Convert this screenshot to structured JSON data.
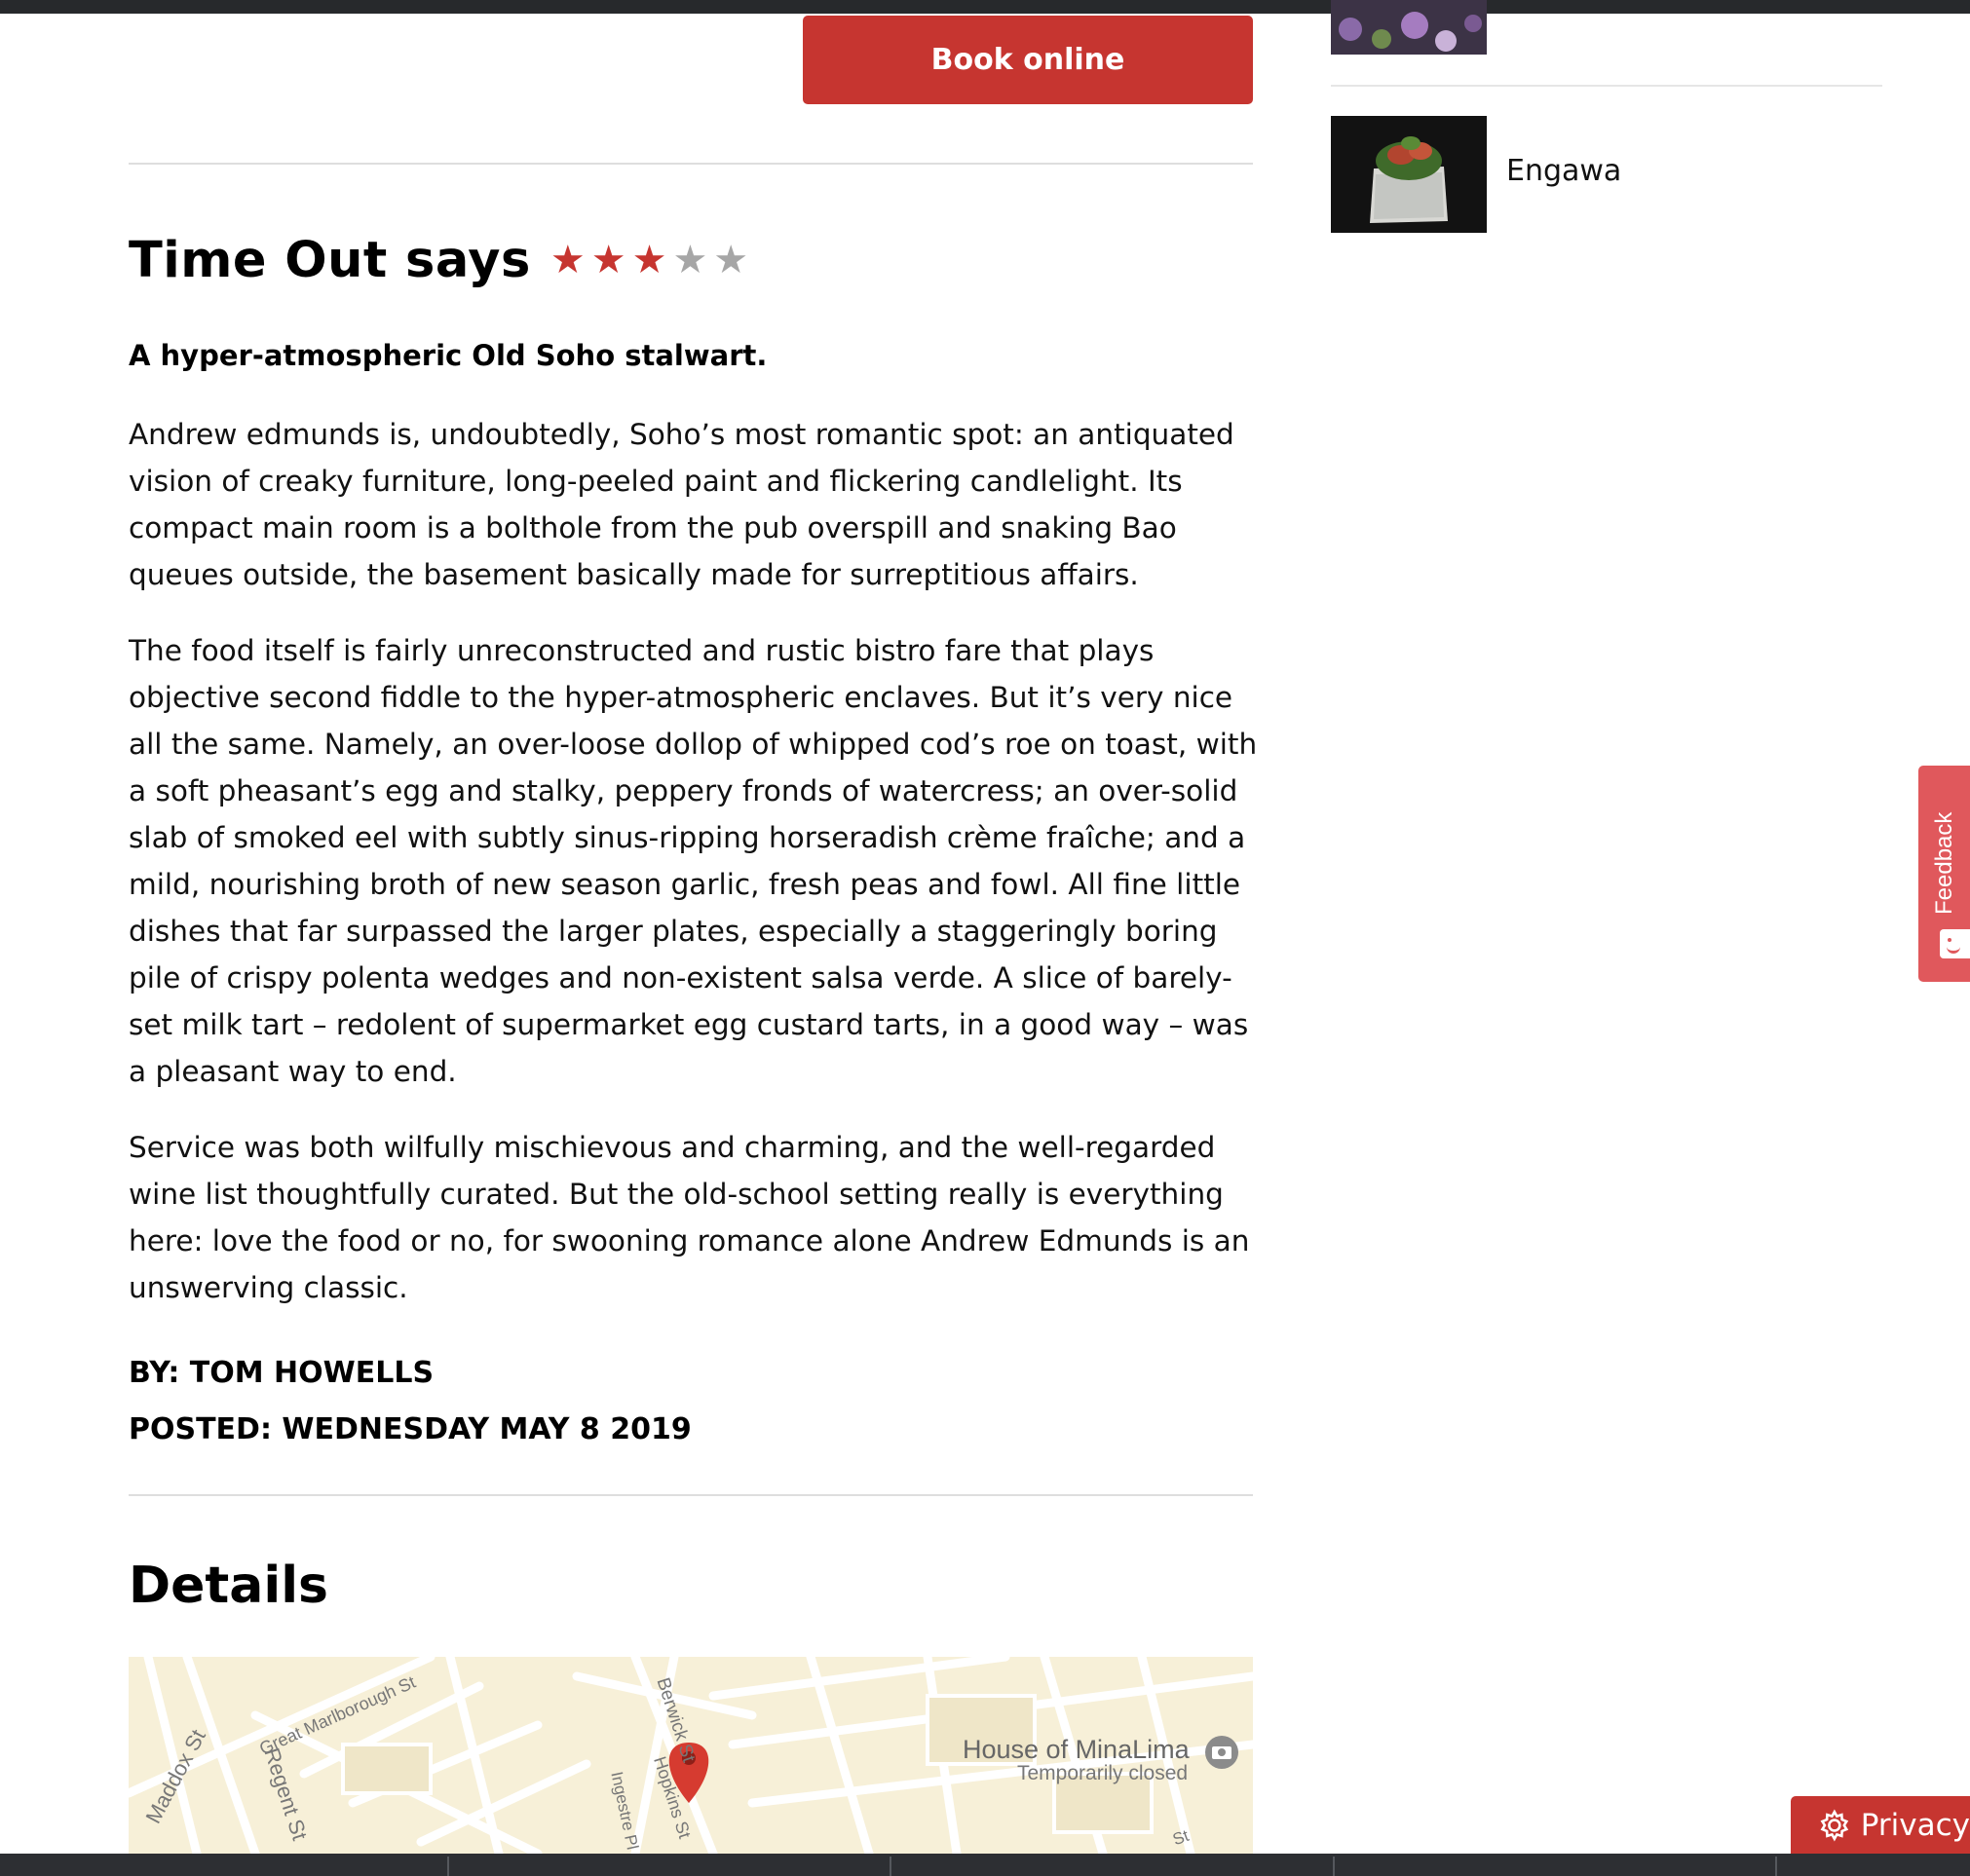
{
  "booking": {
    "button_label": "Book online"
  },
  "review": {
    "heading": "Time Out says",
    "rating": 3,
    "rating_max": 5,
    "subhead": "A hyper-atmospheric Old Soho stalwart.",
    "paragraphs": [
      "Andrew edmunds is, undoubtedly, Soho’s most romantic spot: an antiquated vision of creaky furniture, long-peeled paint and flickering candlelight. Its compact main room is a bolthole from the pub overspill and snaking Bao queues outside, the basement basically made for surreptitious affairs.",
      "The food itself is fairly unreconstructed and rustic bistro fare that plays objective second fiddle to the hyper-atmospheric enclaves. But it’s very nice all the same. Namely, an over-loose dollop of whipped cod’s roe on toast, with a soft pheasant’s egg and stalky, peppery fronds of watercress; an over-solid slab of smoked eel with subtly sinus-ripping horseradish crème fraîche; and a mild, nourishing broth of new season garlic, fresh peas and fowl. All fine little dishes that far surpassed the larger plates, especially a staggeringly boring pile of crispy polenta wedges and non-existent salsa verde. A slice of barely-set milk tart – redolent of supermarket egg custard tarts, in a good way – was a pleasant way to end.",
      "Service was both wilfully mischievous and charming, and the well-regarded wine list thoughtfully curated. But the old-school setting really is everything here: love the food or no, for swooning romance alone Andrew Edmunds is an unswerving classic."
    ],
    "byline": "BY: TOM HOWELLS",
    "posted": "POSTED: WEDNESDAY MAY 8 2019"
  },
  "details": {
    "title": "Details",
    "map": {
      "streets": [
        "Great Marlborough St",
        "Maddox St",
        "Regent St",
        "Berwick St",
        "Hopkins St",
        "Ingestre Pl",
        "St"
      ],
      "place_name": "House of MinaLima",
      "place_status": "Temporarily closed"
    }
  },
  "sidebar": {
    "items": [
      {
        "title": "Engawa",
        "thumb_icon": "food-photo"
      }
    ]
  },
  "feedback": {
    "label": "Feedback"
  },
  "privacy": {
    "label": "Privacy"
  },
  "colors": {
    "accent": "#c63530",
    "star_on": "#c63530",
    "star_off": "#a6a6a6",
    "feedback": "#e0585c",
    "map_bg": "#f7f0d8"
  }
}
